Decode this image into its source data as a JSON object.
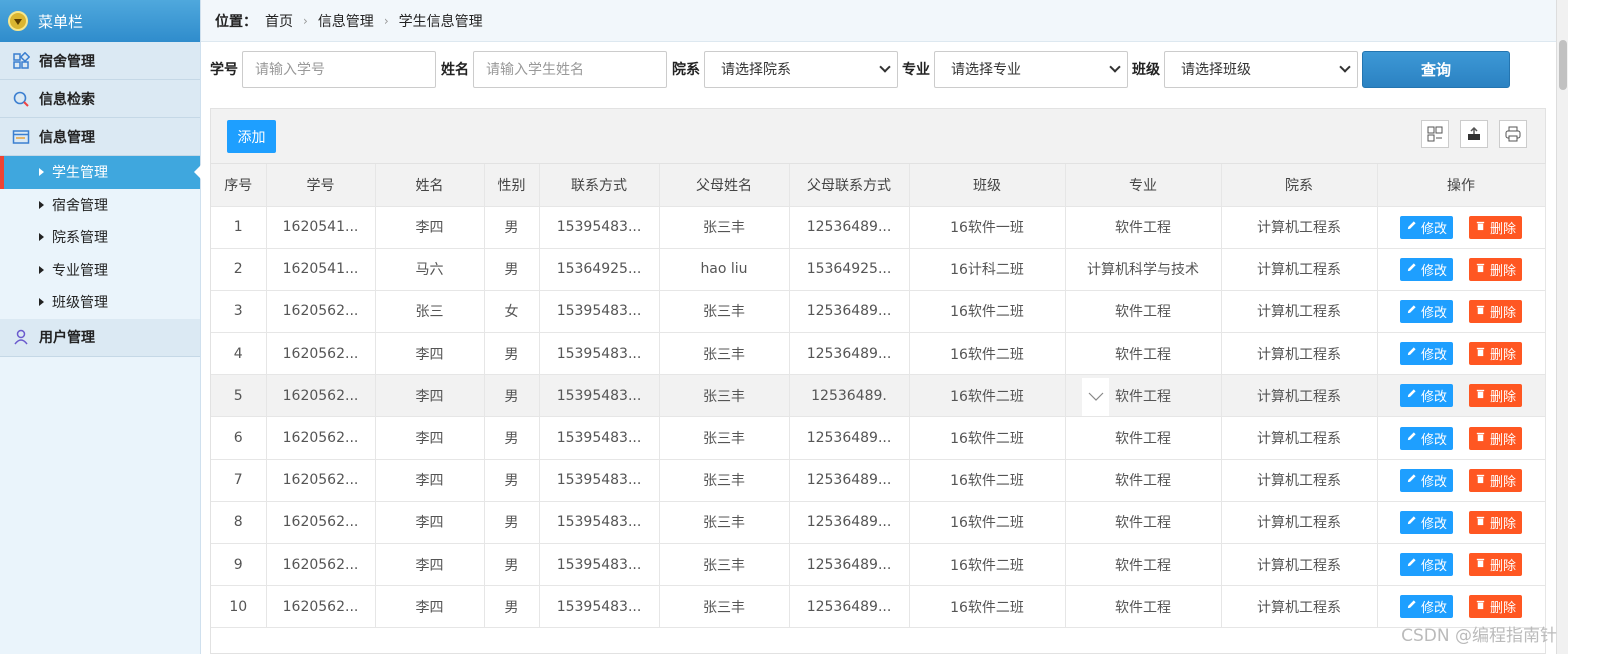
{
  "sidebar": {
    "title": "菜单栏",
    "groups": [
      {
        "label": "宿舍管理"
      },
      {
        "label": "信息检索"
      },
      {
        "label": "信息管理"
      },
      {
        "label": "用户管理"
      }
    ],
    "subitems": [
      {
        "label": "学生管理"
      },
      {
        "label": "宿舍管理"
      },
      {
        "label": "院系管理"
      },
      {
        "label": "专业管理"
      },
      {
        "label": "班级管理"
      }
    ]
  },
  "breadcrumb": {
    "label": "位置：",
    "items": [
      "首页",
      "信息管理",
      "学生信息管理"
    ]
  },
  "filters": {
    "student_id_label": "学号",
    "student_id_placeholder": "请输入学号",
    "name_label": "姓名",
    "name_placeholder": "请输入学生姓名",
    "dept_label": "院系",
    "dept_value": "请选择院系",
    "major_label": "专业",
    "major_value": "请选择专业",
    "class_label": "班级",
    "class_value": "请选择班级",
    "query_label": "查询"
  },
  "toolbar": {
    "add_label": "添加"
  },
  "table": {
    "headers": [
      "序号",
      "学号",
      "姓名",
      "性别",
      "联系方式",
      "父母姓名",
      "父母联系方式",
      "班级",
      "专业",
      "院系",
      "操作"
    ],
    "edit_label": "修改",
    "delete_label": "删除",
    "rows": [
      [
        "1",
        "1620541...",
        "李四",
        "男",
        "15395483...",
        "张三丰",
        "12536489...",
        "16软件一班",
        "软件工程",
        "计算机工程系"
      ],
      [
        "2",
        "1620541...",
        "马六",
        "男",
        "15364925...",
        "hao liu",
        "15364925...",
        "16计科二班",
        "计算机科学与技术",
        "计算机工程系"
      ],
      [
        "3",
        "1620562...",
        "张三",
        "女",
        "15395483...",
        "张三丰",
        "12536489...",
        "16软件二班",
        "软件工程",
        "计算机工程系"
      ],
      [
        "4",
        "1620562...",
        "李四",
        "男",
        "15395483...",
        "张三丰",
        "12536489...",
        "16软件二班",
        "软件工程",
        "计算机工程系"
      ],
      [
        "5",
        "1620562...",
        "李四",
        "男",
        "15395483...",
        "张三丰",
        "12536489.",
        "16软件二班",
        "软件工程",
        "计算机工程系"
      ],
      [
        "6",
        "1620562...",
        "李四",
        "男",
        "15395483...",
        "张三丰",
        "12536489...",
        "16软件二班",
        "软件工程",
        "计算机工程系"
      ],
      [
        "7",
        "1620562...",
        "李四",
        "男",
        "15395483...",
        "张三丰",
        "12536489...",
        "16软件二班",
        "软件工程",
        "计算机工程系"
      ],
      [
        "8",
        "1620562...",
        "李四",
        "男",
        "15395483...",
        "张三丰",
        "12536489...",
        "16软件二班",
        "软件工程",
        "计算机工程系"
      ],
      [
        "9",
        "1620562...",
        "李四",
        "男",
        "15395483...",
        "张三丰",
        "12536489...",
        "16软件二班",
        "软件工程",
        "计算机工程系"
      ],
      [
        "10",
        "1620562...",
        "李四",
        "男",
        "15395483...",
        "张三丰",
        "12536489...",
        "16软件二班",
        "软件工程",
        "计算机工程系"
      ]
    ]
  },
  "watermark": "CSDN @编程指南针",
  "colors": {
    "accent": "#1e9fff",
    "danger": "#ff5722",
    "sidebar_active": "#3fa7de"
  }
}
